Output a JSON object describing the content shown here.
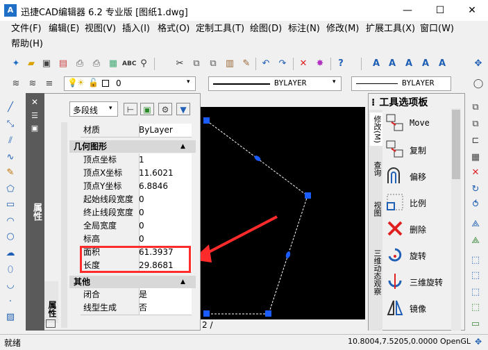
{
  "title": {
    "app": "迅捷CAD编辑器 6.2 专业版",
    "doc": "[图纸1.dwg]",
    "minimize": "—",
    "maximize": "☐",
    "close": "✕",
    "icon": "A"
  },
  "menu": [
    "文件(F)",
    "编辑(E)",
    "视图(V)",
    "插入(I)",
    "格式(O)",
    "定制工具(T)",
    "绘图(D)",
    "标注(N)",
    "修改(M)",
    "扩展工具(X)",
    "窗口(W)",
    "帮助(H)"
  ],
  "layer": {
    "name": "0",
    "linetype": "BYLAYER",
    "lineweight": "BYLAYER"
  },
  "properties": {
    "panel_title": "属性",
    "side_tab": "属性",
    "object_type": "多段线",
    "material_label": "材质",
    "material_value": "ByLayer",
    "geometry_title": "几何图形",
    "geometry": [
      {
        "k": "顶点坐标",
        "v": "1"
      },
      {
        "k": "顶点X坐标",
        "v": "11.6021"
      },
      {
        "k": "顶点Y坐标",
        "v": "6.8846"
      },
      {
        "k": "起始线段宽度",
        "v": "0"
      },
      {
        "k": "终止线段宽度",
        "v": "0"
      },
      {
        "k": "全局宽度",
        "v": "0"
      },
      {
        "k": "标高",
        "v": "0"
      },
      {
        "k": "面积",
        "v": "61.3937"
      },
      {
        "k": "长度",
        "v": "29.8681"
      }
    ],
    "other_title": "其他",
    "other": [
      {
        "k": "闭合",
        "v": "是"
      },
      {
        "k": "线型生成",
        "v": "否"
      }
    ]
  },
  "canvas": {
    "tab_fragment": "2 /",
    "highlight_color": "#ff2a2a"
  },
  "tool_palette": {
    "title": "工具选项板",
    "tabs": [
      "修改(M)",
      "查询",
      "视图",
      "三维动态观察"
    ],
    "items": [
      {
        "label": "Move",
        "icon": "move-icon"
      },
      {
        "label": "复制",
        "icon": "copy-icon"
      },
      {
        "label": "偏移",
        "icon": "offset-icon"
      },
      {
        "label": "比例",
        "icon": "scale-icon"
      },
      {
        "label": "删除",
        "icon": "delete-icon"
      },
      {
        "label": "旋转",
        "icon": "rotate-icon"
      },
      {
        "label": "三维旋转",
        "icon": "rotate3d-icon"
      },
      {
        "label": "镜像",
        "icon": "mirror-icon"
      }
    ]
  },
  "status": {
    "left": "就绪",
    "coords": "10.8004,7.5205,0.0000",
    "renderer": "OpenGL"
  }
}
